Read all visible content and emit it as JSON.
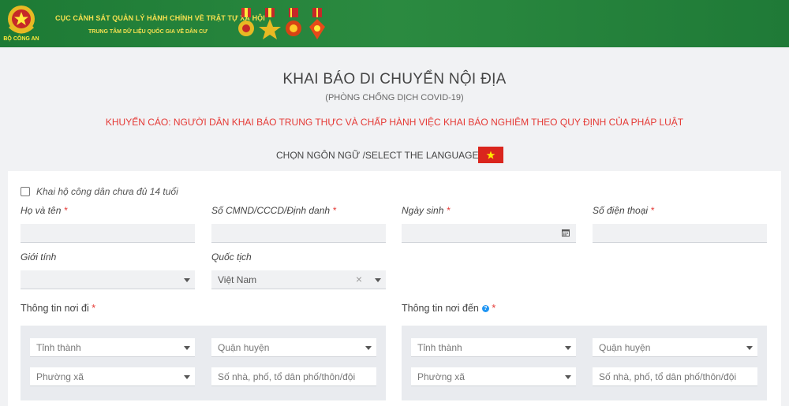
{
  "header": {
    "org_line1": "CỤC CẢNH SÁT QUẢN LÝ HÀNH CHÍNH VỀ TRẬT TỰ XÃ HỘI",
    "org_line2": "TRUNG TÂM DỮ LIỆU QUỐC GIA VỀ DÂN CƯ",
    "logo_text": "BỘ CÔNG AN"
  },
  "page": {
    "title": "KHAI BÁO DI CHUYỂN NỘI ĐỊA",
    "subtitle": "(PHÒNG CHỐNG DỊCH COVID-19)",
    "warning": "KHUYẾN CÁO: NGƯỜI DÂN KHAI BÁO TRUNG THỰC VÀ CHẤP HÀNH VIỆC KHAI BÁO NGHIÊM THEO QUY ĐỊNH CỦA PHÁP LUẬT",
    "language_label": "CHỌN NGÔN NGỮ /SELECT THE LANGUAGE:"
  },
  "form": {
    "minor_checkbox_label": "Khai hộ công dân chưa đủ 14 tuổi",
    "required_mark": "*",
    "full_name_label": "Họ và tên",
    "id_number_label": "Số CMND/CCCD/Định danh",
    "dob_label": "Ngày sinh",
    "phone_label": "Số điện thoại",
    "gender_label": "Giới tính",
    "nationality_label": "Quốc tịch",
    "nationality_value": "Việt Nam",
    "clear_symbol": "×",
    "departure_label": "Thông tin nơi đi",
    "destination_label": "Thông tin nơi đến",
    "help_symbol": "?",
    "departure": {
      "province_placeholder": "Tỉnh thành",
      "district_placeholder": "Quận huyện",
      "ward_placeholder": "Phường xã",
      "address_placeholder": "Số nhà, phố, tổ dân phố/thôn/đội"
    },
    "destination": {
      "province_placeholder": "Tỉnh thành",
      "district_placeholder": "Quận huyện",
      "ward_placeholder": "Phường xã",
      "address_placeholder": "Số nhà, phố, tổ dân phố/thôn/đội"
    }
  },
  "colors": {
    "header_green": "#1f7a3a",
    "header_text": "#f5e050",
    "warning_red": "#e53935",
    "flag_red": "#da251d",
    "flag_star": "#ffeb00"
  }
}
